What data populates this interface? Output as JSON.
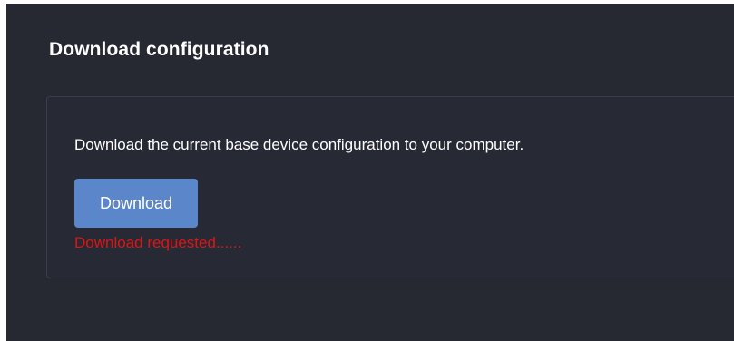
{
  "section": {
    "title": "Download configuration"
  },
  "card": {
    "description": "Download the current base device configuration to your computer.",
    "download_label": "Download",
    "status_text": "Download requested......"
  },
  "colors": {
    "background": "#262832",
    "button": "#5b86c9",
    "status": "#e01414"
  }
}
